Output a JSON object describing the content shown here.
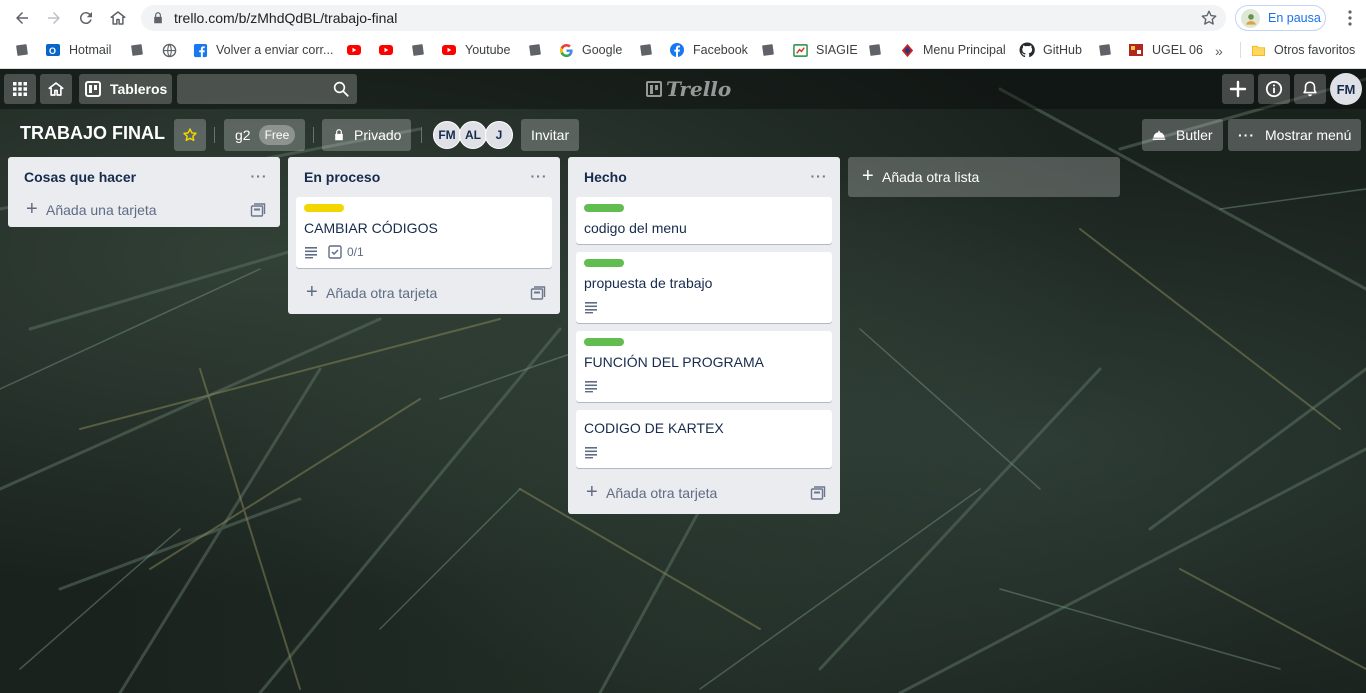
{
  "browser": {
    "url": "trello.com/b/zMhdQdBL/trabajo-final",
    "profile_label": "En pausa",
    "bookmarks": [
      {
        "label": "",
        "icon": "bookmark-icon"
      },
      {
        "label": "Hotmail",
        "icon": "outlook-icon"
      },
      {
        "label": "",
        "icon": "bookmark-icon"
      },
      {
        "label": "",
        "icon": "globe-icon"
      },
      {
        "label": "Volver a enviar corr...",
        "icon": "facebook-icon"
      },
      {
        "label": "",
        "icon": "youtube-icon"
      },
      {
        "label": "",
        "icon": "youtube-icon"
      },
      {
        "label": "",
        "icon": "bookmark-icon"
      },
      {
        "label": "Youtube",
        "icon": "youtube-icon"
      },
      {
        "label": "",
        "icon": "bookmark-icon"
      },
      {
        "label": "Google",
        "icon": "google-icon"
      },
      {
        "label": "",
        "icon": "bookmark-icon"
      },
      {
        "label": "Facebook",
        "icon": "facebook-icon"
      },
      {
        "label": "",
        "icon": "bookmark-icon"
      },
      {
        "label": "SIAGIE",
        "icon": "siagie-icon"
      },
      {
        "label": "",
        "icon": "bookmark-icon"
      },
      {
        "label": "Menu Principal",
        "icon": "menu-principal-icon"
      },
      {
        "label": "GitHub",
        "icon": "github-icon"
      },
      {
        "label": "",
        "icon": "bookmark-icon"
      },
      {
        "label": "UGEL 06",
        "icon": "ugel-icon"
      }
    ],
    "more_bookmarks": "»",
    "other_bookmarks": "Otros favoritos"
  },
  "header": {
    "boards_label": "Tableros",
    "logo_text": "Trello",
    "user_initials": "FM"
  },
  "board": {
    "title": "TRABAJO FINAL",
    "team_name": "g2",
    "team_badge": "Free",
    "visibility": "Privado",
    "members": [
      "FM",
      "AL",
      "J"
    ],
    "invite_label": "Invitar",
    "butler_label": "Butler",
    "menu_label": "Mostrar menú",
    "add_list_label": "Añada otra lista"
  },
  "lists": [
    {
      "title": "Cosas que hacer",
      "add_card": "Añada una tarjeta",
      "cards": []
    },
    {
      "title": "En proceso",
      "add_card": "Añada otra tarjeta",
      "cards": [
        {
          "label_color": "#f2d600",
          "title": "CAMBIAR CÓDIGOS",
          "has_description": true,
          "checklist": "0/1"
        }
      ]
    },
    {
      "title": "Hecho",
      "add_card": "Añada otra tarjeta",
      "cards": [
        {
          "label_color": "#61bd4f",
          "title": "codigo del menu",
          "has_description": false,
          "checklist": ""
        },
        {
          "label_color": "#61bd4f",
          "title": "propuesta de trabajo",
          "has_description": true,
          "checklist": ""
        },
        {
          "label_color": "#61bd4f",
          "title": "FUNCIÓN DEL PROGRAMA",
          "has_description": true,
          "checklist": ""
        },
        {
          "label_color": "",
          "title": "CODIGO DE KARTEX",
          "has_description": true,
          "checklist": ""
        }
      ]
    }
  ],
  "colors": {
    "list_bg": "#ebecf0",
    "text_primary": "#172b4d",
    "label_yellow": "#f2d600",
    "label_green": "#61bd4f",
    "chrome_accent": "#1a73e8"
  }
}
